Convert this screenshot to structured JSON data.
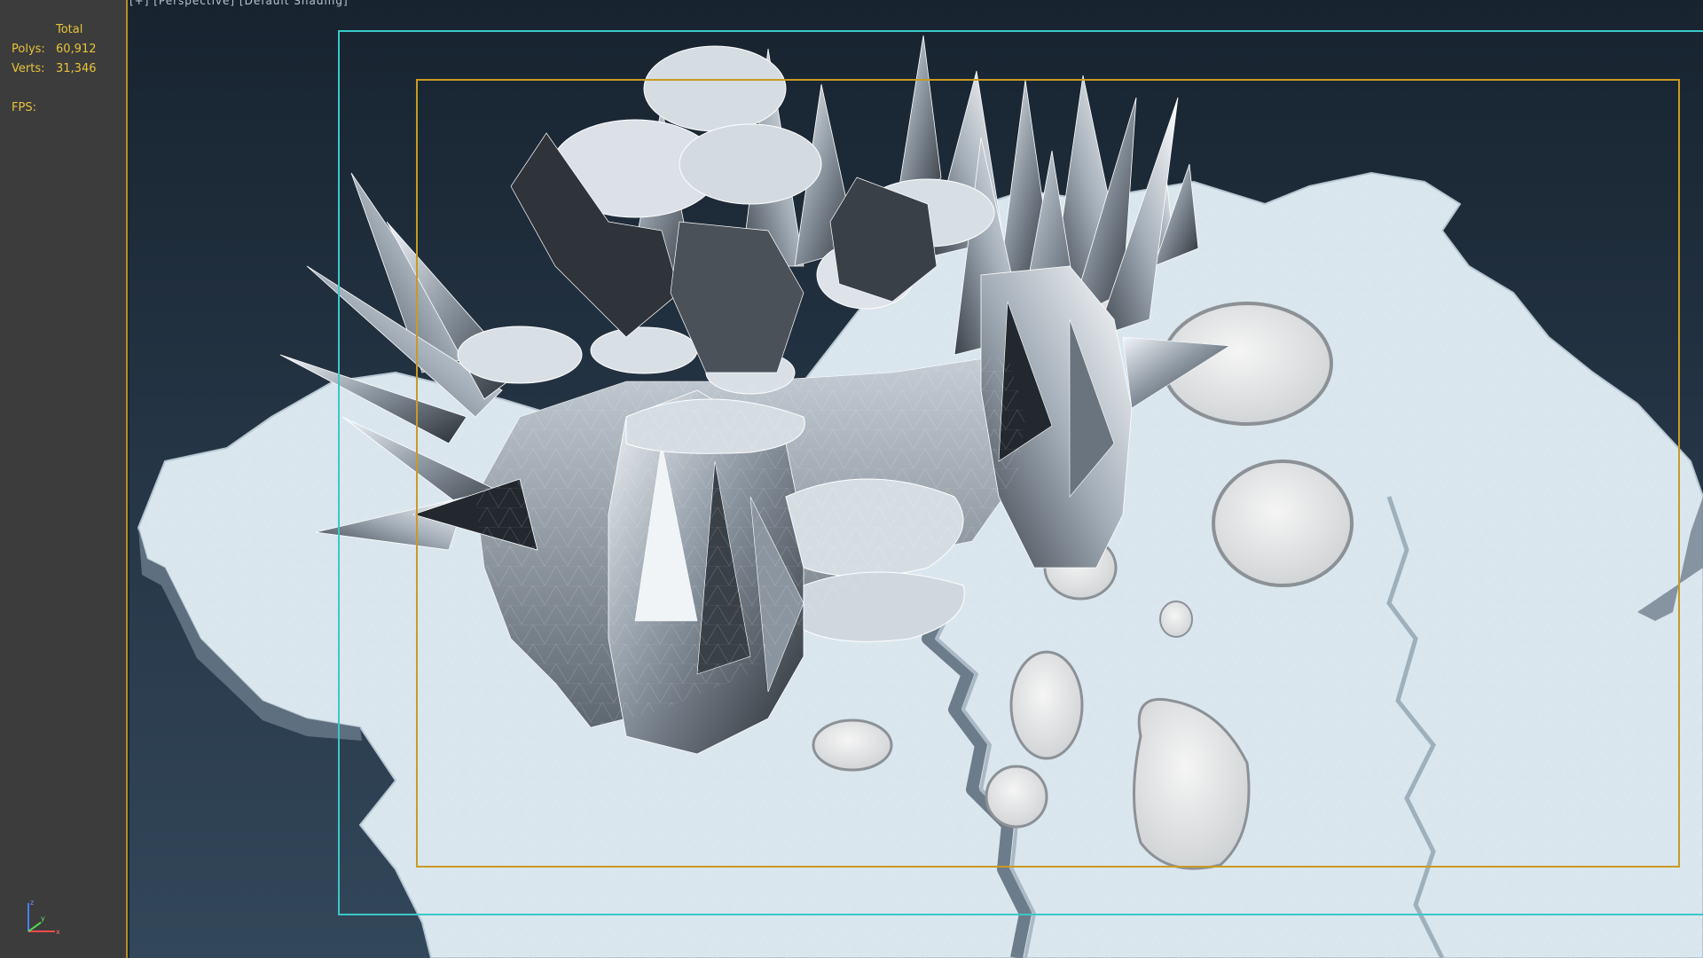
{
  "viewport": {
    "label": "[+] [Perspective] [Default Shading]"
  },
  "stats": {
    "total_label": "Total",
    "polys_label": "Polys:",
    "polys_value": "60,912",
    "verts_label": "Verts:",
    "verts_value": "31,346",
    "fps_label": "FPS:",
    "fps_value": ""
  },
  "gizmo": {
    "z_label": "z",
    "x_label": "x",
    "y_label": "y"
  },
  "colors": {
    "stats_text": "#e8c33a",
    "panel_bg": "#3c3c3c",
    "safe_frame_outer": "#3ac8c8",
    "safe_frame_inner": "#c89b22",
    "mesh_fill": "#d9e6ee"
  }
}
